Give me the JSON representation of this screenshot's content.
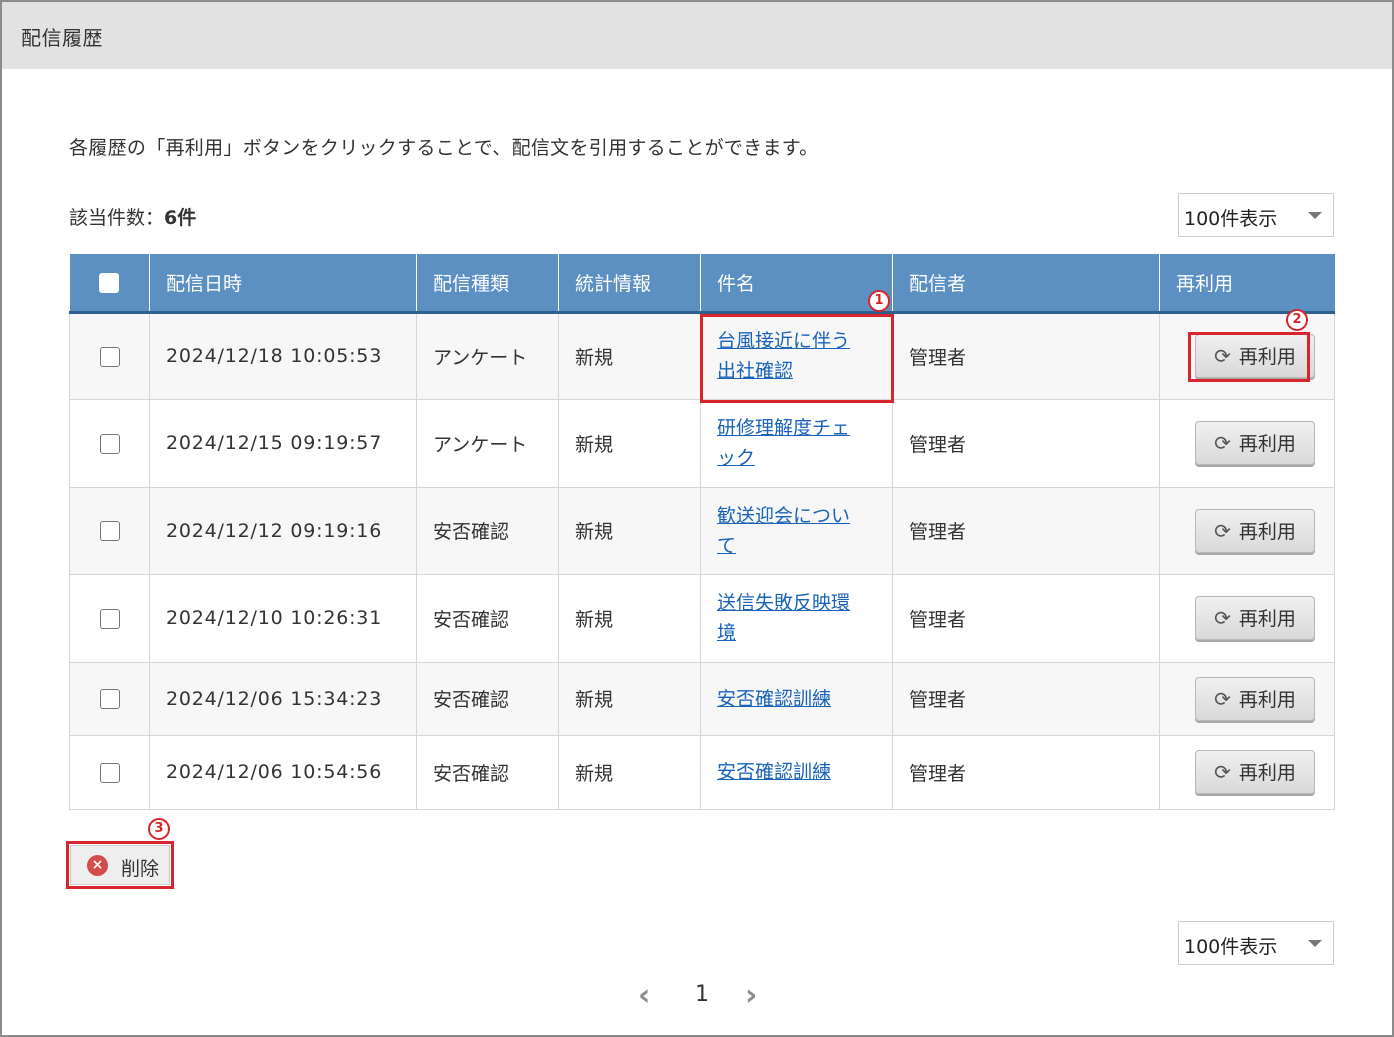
{
  "header": {
    "title": "配信履歴"
  },
  "description": "各履歴の「再利用」ボタンをクリックすることで、配信文を引用することができます。",
  "result": {
    "label": "該当件数：",
    "count": "6件"
  },
  "page_size": {
    "selected": "100件表示"
  },
  "columns": [
    "配信日時",
    "配信種類",
    "統計情報",
    "件名",
    "配信者",
    "再利用"
  ],
  "rows": [
    {
      "date": "2024/12/18 10:05:53",
      "type": "アンケート",
      "stats": "新規",
      "subject_l1": "台風接近に伴う",
      "subject_l2": "出社確認",
      "sender": "管理者",
      "reuse": "再利用"
    },
    {
      "date": "2024/12/15 09:19:57",
      "type": "アンケート",
      "stats": "新規",
      "subject_l1": "研修理解度チェ",
      "subject_l2": "ック",
      "sender": "管理者",
      "reuse": "再利用"
    },
    {
      "date": "2024/12/12 09:19:16",
      "type": "安否確認",
      "stats": "新規",
      "subject_l1": "歓送迎会につい",
      "subject_l2": "て",
      "sender": "管理者",
      "reuse": "再利用"
    },
    {
      "date": "2024/12/10 10:26:31",
      "type": "安否確認",
      "stats": "新規",
      "subject_l1": "送信失敗反映環",
      "subject_l2": "境",
      "sender": "管理者",
      "reuse": "再利用"
    },
    {
      "date": "2024/12/06 15:34:23",
      "type": "安否確認",
      "stats": "新規",
      "subject_l1": "安否確認訓練",
      "subject_l2": "",
      "sender": "管理者",
      "reuse": "再利用"
    },
    {
      "date": "2024/12/06 10:54:56",
      "type": "安否確認",
      "stats": "新規",
      "subject_l1": "安否確認訓練",
      "subject_l2": "",
      "sender": "管理者",
      "reuse": "再利用"
    }
  ],
  "delete_button": {
    "label": "削除"
  },
  "callouts": [
    "1",
    "2",
    "3"
  ],
  "pagination": {
    "current": "1",
    "prev_icon": "chevron-left-icon",
    "next_icon": "chevron-right-icon"
  },
  "colors": {
    "header_bg": "#5c8fc2",
    "link": "#1a63b8",
    "highlight": "#d8242c",
    "titlebar": "#e2e2e2"
  }
}
